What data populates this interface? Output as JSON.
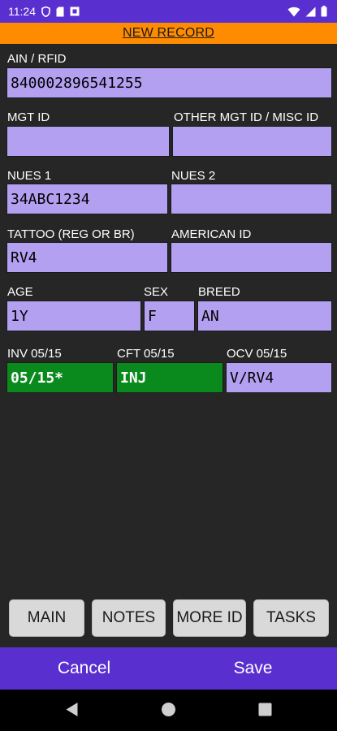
{
  "status_bar": {
    "time": "11:24",
    "icons": [
      "shield-icon",
      "sim-card-icon",
      "square-box-icon",
      "wifi-icon",
      "signal-icon",
      "battery-icon"
    ]
  },
  "title": "NEW RECORD",
  "fields": {
    "ain_rfid": {
      "label": "AIN / RFID",
      "value": "840002896541255"
    },
    "mgt_id": {
      "label": "MGT ID",
      "value": ""
    },
    "other_mgt_id": {
      "label": "OTHER MGT ID / MISC ID",
      "value": ""
    },
    "nues1": {
      "label": "NUES 1",
      "value": "34ABC1234"
    },
    "nues2": {
      "label": "NUES 2",
      "value": ""
    },
    "tattoo": {
      "label": "TATTOO (REG OR BR)",
      "value": "RV4"
    },
    "american_id": {
      "label": "AMERICAN ID",
      "value": ""
    },
    "age": {
      "label": "AGE",
      "value": "1Y"
    },
    "sex": {
      "label": "SEX",
      "value": "F"
    },
    "breed": {
      "label": "BREED",
      "value": "AN"
    },
    "inv": {
      "label": "INV 05/15",
      "value": "05/15*"
    },
    "cft": {
      "label": "CFT 05/15",
      "value": "INJ"
    },
    "ocv": {
      "label": "OCV 05/15",
      "value": "V/RV4"
    }
  },
  "nav_buttons": {
    "main": "MAIN",
    "notes": "NOTES",
    "more_id": "MORE ID",
    "tasks": "TASKS"
  },
  "actions": {
    "cancel": "Cancel",
    "save": "Save"
  },
  "colors": {
    "status_bar": "#5a2fd0",
    "title_bar": "#ff8c00",
    "field": "#b3a0f0",
    "field_highlight": "#0a8a1c",
    "background": "#262626"
  }
}
